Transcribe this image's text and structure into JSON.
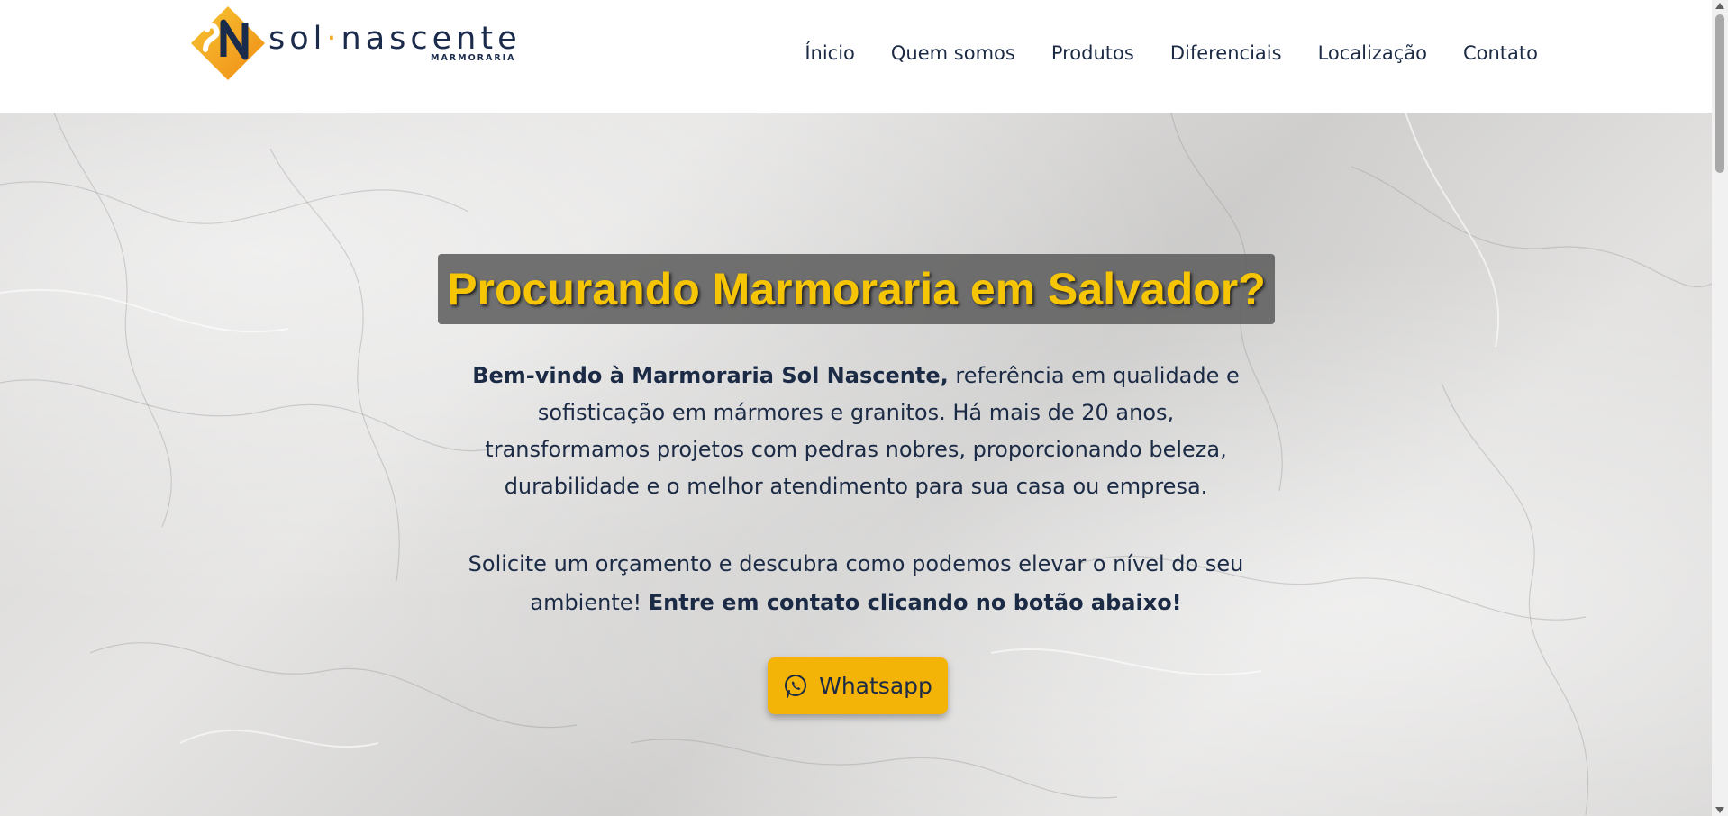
{
  "header": {
    "brand_prefix": "sol",
    "brand_suffix": "nascente",
    "brand_sub": "MARMORARIA",
    "nav": [
      "Ínicio",
      "Quem somos",
      "Produtos",
      "Diferenciais",
      "Localização",
      "Contato"
    ]
  },
  "hero": {
    "headline": "Procurando Marmoraria em Salvador?",
    "intro_bold": "Bem-vindo à Marmoraria Sol Nascente,",
    "intro_rest": " referência em qualidade e sofisticação em mármores e granitos. Há mais de 20 anos, transformamos projetos com pedras nobres, proporcionando beleza, durabilidade e o melhor atendimento para sua casa ou empresa.",
    "cta_plain": "Solicite um orçamento e descubra como podemos elevar o nível do seu ambiente! ",
    "cta_bold": "Entre em contato clicando no botão abaixo!",
    "button_label": "Whatsapp",
    "button_icon": "whatsapp-icon"
  },
  "colors": {
    "accent": "#f4b407",
    "headline_text": "#f5c506",
    "navy": "#1b2a45",
    "headline_box": "#5f5f5f"
  }
}
